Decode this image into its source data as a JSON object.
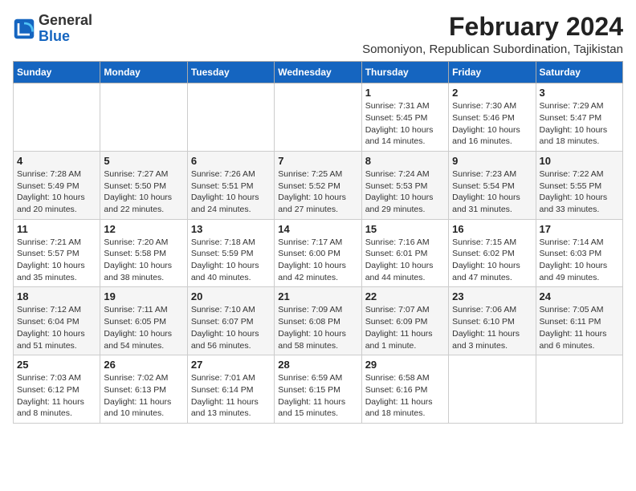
{
  "header": {
    "logo_general": "General",
    "logo_blue": "Blue",
    "month_title": "February 2024",
    "location": "Somoniyon, Republican Subordination, Tajikistan"
  },
  "weekdays": [
    "Sunday",
    "Monday",
    "Tuesday",
    "Wednesday",
    "Thursday",
    "Friday",
    "Saturday"
  ],
  "weeks": [
    [
      {
        "day": "",
        "info": ""
      },
      {
        "day": "",
        "info": ""
      },
      {
        "day": "",
        "info": ""
      },
      {
        "day": "",
        "info": ""
      },
      {
        "day": "1",
        "info": "Sunrise: 7:31 AM\nSunset: 5:45 PM\nDaylight: 10 hours\nand 14 minutes."
      },
      {
        "day": "2",
        "info": "Sunrise: 7:30 AM\nSunset: 5:46 PM\nDaylight: 10 hours\nand 16 minutes."
      },
      {
        "day": "3",
        "info": "Sunrise: 7:29 AM\nSunset: 5:47 PM\nDaylight: 10 hours\nand 18 minutes."
      }
    ],
    [
      {
        "day": "4",
        "info": "Sunrise: 7:28 AM\nSunset: 5:49 PM\nDaylight: 10 hours\nand 20 minutes."
      },
      {
        "day": "5",
        "info": "Sunrise: 7:27 AM\nSunset: 5:50 PM\nDaylight: 10 hours\nand 22 minutes."
      },
      {
        "day": "6",
        "info": "Sunrise: 7:26 AM\nSunset: 5:51 PM\nDaylight: 10 hours\nand 24 minutes."
      },
      {
        "day": "7",
        "info": "Sunrise: 7:25 AM\nSunset: 5:52 PM\nDaylight: 10 hours\nand 27 minutes."
      },
      {
        "day": "8",
        "info": "Sunrise: 7:24 AM\nSunset: 5:53 PM\nDaylight: 10 hours\nand 29 minutes."
      },
      {
        "day": "9",
        "info": "Sunrise: 7:23 AM\nSunset: 5:54 PM\nDaylight: 10 hours\nand 31 minutes."
      },
      {
        "day": "10",
        "info": "Sunrise: 7:22 AM\nSunset: 5:55 PM\nDaylight: 10 hours\nand 33 minutes."
      }
    ],
    [
      {
        "day": "11",
        "info": "Sunrise: 7:21 AM\nSunset: 5:57 PM\nDaylight: 10 hours\nand 35 minutes."
      },
      {
        "day": "12",
        "info": "Sunrise: 7:20 AM\nSunset: 5:58 PM\nDaylight: 10 hours\nand 38 minutes."
      },
      {
        "day": "13",
        "info": "Sunrise: 7:18 AM\nSunset: 5:59 PM\nDaylight: 10 hours\nand 40 minutes."
      },
      {
        "day": "14",
        "info": "Sunrise: 7:17 AM\nSunset: 6:00 PM\nDaylight: 10 hours\nand 42 minutes."
      },
      {
        "day": "15",
        "info": "Sunrise: 7:16 AM\nSunset: 6:01 PM\nDaylight: 10 hours\nand 44 minutes."
      },
      {
        "day": "16",
        "info": "Sunrise: 7:15 AM\nSunset: 6:02 PM\nDaylight: 10 hours\nand 47 minutes."
      },
      {
        "day": "17",
        "info": "Sunrise: 7:14 AM\nSunset: 6:03 PM\nDaylight: 10 hours\nand 49 minutes."
      }
    ],
    [
      {
        "day": "18",
        "info": "Sunrise: 7:12 AM\nSunset: 6:04 PM\nDaylight: 10 hours\nand 51 minutes."
      },
      {
        "day": "19",
        "info": "Sunrise: 7:11 AM\nSunset: 6:05 PM\nDaylight: 10 hours\nand 54 minutes."
      },
      {
        "day": "20",
        "info": "Sunrise: 7:10 AM\nSunset: 6:07 PM\nDaylight: 10 hours\nand 56 minutes."
      },
      {
        "day": "21",
        "info": "Sunrise: 7:09 AM\nSunset: 6:08 PM\nDaylight: 10 hours\nand 58 minutes."
      },
      {
        "day": "22",
        "info": "Sunrise: 7:07 AM\nSunset: 6:09 PM\nDaylight: 11 hours\nand 1 minute."
      },
      {
        "day": "23",
        "info": "Sunrise: 7:06 AM\nSunset: 6:10 PM\nDaylight: 11 hours\nand 3 minutes."
      },
      {
        "day": "24",
        "info": "Sunrise: 7:05 AM\nSunset: 6:11 PM\nDaylight: 11 hours\nand 6 minutes."
      }
    ],
    [
      {
        "day": "25",
        "info": "Sunrise: 7:03 AM\nSunset: 6:12 PM\nDaylight: 11 hours\nand 8 minutes."
      },
      {
        "day": "26",
        "info": "Sunrise: 7:02 AM\nSunset: 6:13 PM\nDaylight: 11 hours\nand 10 minutes."
      },
      {
        "day": "27",
        "info": "Sunrise: 7:01 AM\nSunset: 6:14 PM\nDaylight: 11 hours\nand 13 minutes."
      },
      {
        "day": "28",
        "info": "Sunrise: 6:59 AM\nSunset: 6:15 PM\nDaylight: 11 hours\nand 15 minutes."
      },
      {
        "day": "29",
        "info": "Sunrise: 6:58 AM\nSunset: 6:16 PM\nDaylight: 11 hours\nand 18 minutes."
      },
      {
        "day": "",
        "info": ""
      },
      {
        "day": "",
        "info": ""
      }
    ]
  ]
}
